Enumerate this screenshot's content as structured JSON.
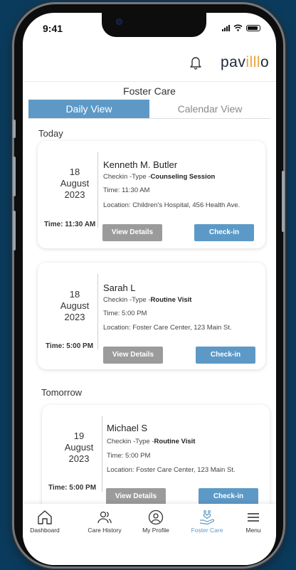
{
  "status_bar": {
    "time": "9:41"
  },
  "header": {
    "logo": {
      "left": "pav",
      "mid": "illl",
      "right": "o"
    }
  },
  "page_title": "Foster Care",
  "tabs": [
    {
      "label": "Daily View",
      "active": true
    },
    {
      "label": "Calendar View",
      "active": false
    }
  ],
  "sections": {
    "today": "Today",
    "tomorrow": "Tomorrow"
  },
  "appointments": [
    {
      "day": "18",
      "month": "August",
      "year": "2023",
      "time_label": "Time: 11:30 AM",
      "name": "Kenneth M. Butler",
      "checkin_prefix": "Checkin -Type -",
      "checkin_type": "Counseling Session",
      "time": "Time: 11:30 AM",
      "location": "Location: Children's Hospital, 456 Health Ave.",
      "details_label": "View Details",
      "checkin_label": "Check-in"
    },
    {
      "day": "18",
      "month": "August",
      "year": "2023",
      "time_label": "Time: 5:00 PM",
      "name": "Sarah L",
      "checkin_prefix": "Checkin -Type -",
      "checkin_type": "Routine Visit",
      "time": "Time: 5:00 PM",
      "location": "Location: Foster Care Center, 123 Main St.",
      "details_label": "View Details",
      "checkin_label": "Check-in"
    },
    {
      "day": "19",
      "month": "August",
      "year": "2023",
      "time_label": "Time: 5:00 PM",
      "name": "Michael S",
      "checkin_prefix": "Checkin -Type -",
      "checkin_type": "Routine Visit",
      "time": "Time: 5:00 PM",
      "location": "Location: Foster Care Center, 123 Main St.",
      "details_label": "View Details",
      "checkin_label": "Check-in"
    }
  ],
  "bottom_nav": [
    {
      "label": "Dashboard",
      "icon": "home-icon",
      "active": false
    },
    {
      "label": "Care History",
      "icon": "users-icon",
      "active": false
    },
    {
      "label": "My Profile",
      "icon": "profile-icon",
      "active": false
    },
    {
      "label": "Foster Care",
      "icon": "hand-heart-icon",
      "active": true
    },
    {
      "label": "Menu",
      "icon": "menu-icon",
      "active": false
    }
  ],
  "colors": {
    "accent": "#5d99c6",
    "gray_button": "#9b9b9b",
    "background": "#0b3b5c"
  }
}
